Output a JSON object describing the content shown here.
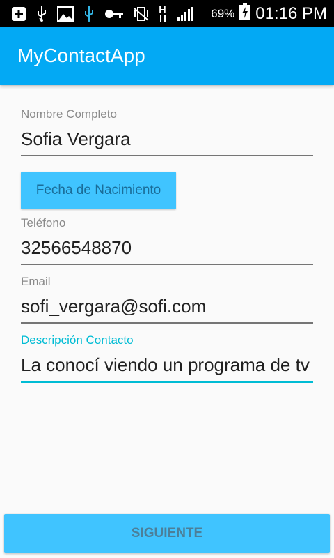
{
  "status_bar": {
    "battery_percent": "69%",
    "time": "01:16 PM",
    "icons": [
      "add-box-icon",
      "usb-icon",
      "image-icon",
      "usb-debug-icon",
      "key-icon",
      "vibrate-icon",
      "hspa-icon",
      "signal-icon",
      "battery-charging-icon"
    ]
  },
  "app_bar": {
    "title": "MyContactApp",
    "color": "#03a9f4"
  },
  "form": {
    "name": {
      "label": "Nombre Completo",
      "value": "Sofia Vergara"
    },
    "date_button": {
      "label": "Fecha de Nacimiento"
    },
    "phone": {
      "label": "Teléfono",
      "value": "32566548870"
    },
    "email": {
      "label": "Email",
      "value": "sofi_vergara@sofi.com"
    },
    "description": {
      "label": "Descripción Contacto",
      "value": "La conocí viendo un programa de tv"
    }
  },
  "next_button": {
    "label": "SIGUIENTE"
  },
  "colors": {
    "accent": "#00bcd4",
    "button": "#40c4ff"
  }
}
